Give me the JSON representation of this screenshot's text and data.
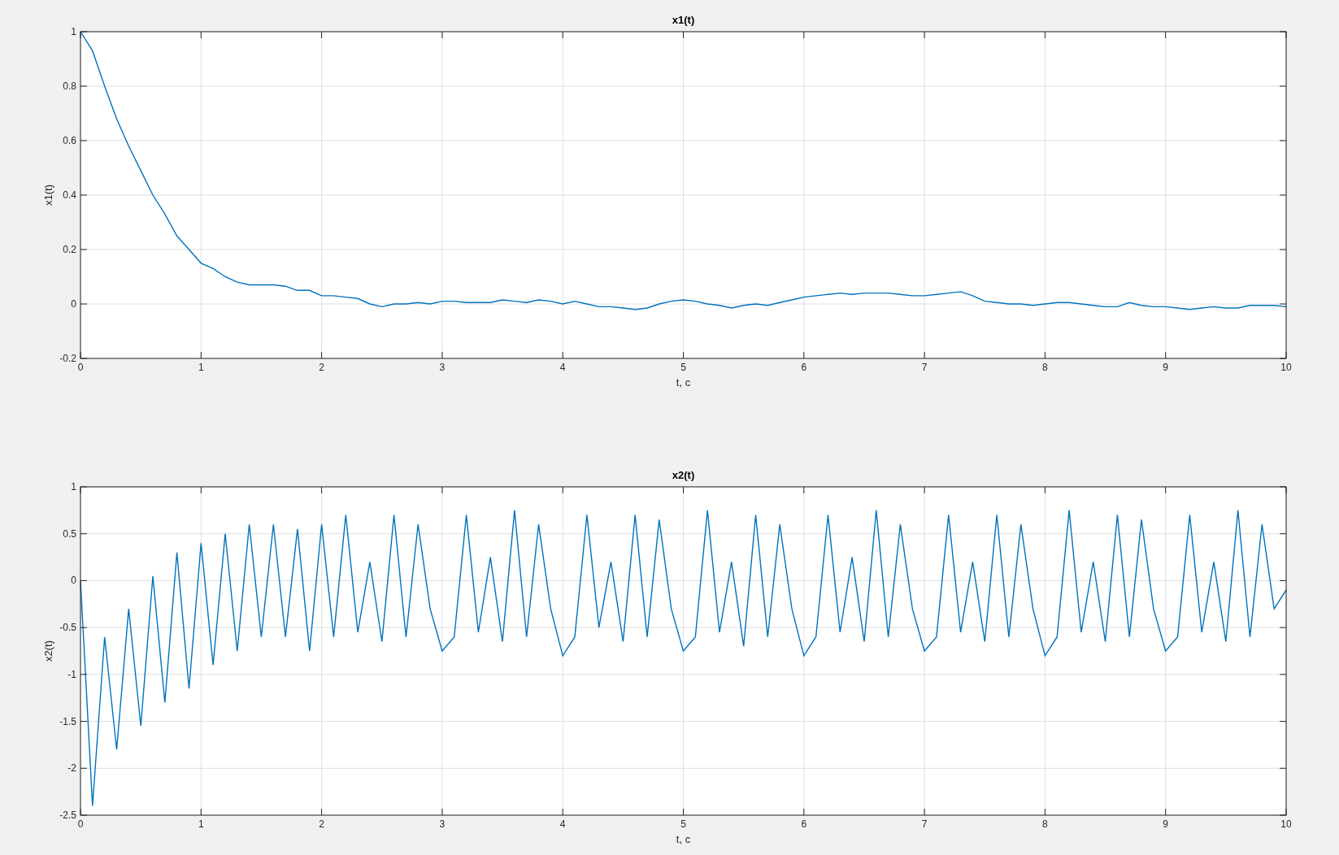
{
  "figure": {
    "plots": [
      {
        "chart_data": {
          "type": "line",
          "title": "x1(t)",
          "xlabel": "t, c",
          "ylabel": "x1(t)",
          "x": [
            0,
            0.1,
            0.2,
            0.3,
            0.4,
            0.5,
            0.6,
            0.7,
            0.8,
            0.9,
            1,
            1.1,
            1.2,
            1.3,
            1.4,
            1.5,
            1.6,
            1.7,
            1.8,
            1.9,
            2,
            2.1,
            2.2,
            2.3,
            2.4,
            2.5,
            2.6,
            2.7,
            2.8,
            2.9,
            3,
            3.1,
            3.2,
            3.3,
            3.4,
            3.5,
            3.6,
            3.7,
            3.8,
            3.9,
            4,
            4.1,
            4.2,
            4.3,
            4.4,
            4.5,
            4.6,
            4.7,
            4.8,
            4.9,
            5,
            5.1,
            5.2,
            5.3,
            5.4,
            5.5,
            5.6,
            5.7,
            5.8,
            5.9,
            6,
            6.1,
            6.2,
            6.3,
            6.4,
            6.5,
            6.6,
            6.7,
            6.8,
            6.9,
            7,
            7.1,
            7.2,
            7.3,
            7.4,
            7.5,
            7.6,
            7.7,
            7.8,
            7.9,
            8,
            8.1,
            8.2,
            8.3,
            8.4,
            8.5,
            8.6,
            8.7,
            8.8,
            8.9,
            9,
            9.1,
            9.2,
            9.3,
            9.4,
            9.5,
            9.6,
            9.7,
            9.8,
            9.9,
            10
          ],
          "series": [
            {
              "color": "#0072bd",
              "values": [
                1,
                0.93,
                0.8,
                0.68,
                0.58,
                0.49,
                0.4,
                0.33,
                0.25,
                0.2,
                0.15,
                0.13,
                0.1,
                0.08,
                0.07,
                0.07,
                0.07,
                0.065,
                0.05,
                0.05,
                0.03,
                0.03,
                0.025,
                0.02,
                0,
                -0.01,
                0,
                0,
                0.005,
                0,
                0.01,
                0.01,
                0.005,
                0.005,
                0.005,
                0.015,
                0.01,
                0.005,
                0.015,
                0.01,
                0,
                0.01,
                0,
                -0.01,
                -0.01,
                -0.015,
                -0.02,
                -0.015,
                0,
                0.01,
                0.015,
                0.01,
                0,
                -0.005,
                -0.015,
                -0.005,
                0,
                -0.005,
                0.005,
                0.015,
                0.025,
                0.03,
                0.035,
                0.04,
                0.035,
                0.04,
                0.04,
                0.04,
                0.035,
                0.03,
                0.03,
                0.035,
                0.04,
                0.045,
                0.03,
                0.01,
                0.005,
                0,
                0,
                -0.005,
                0,
                0.005,
                0.005,
                0,
                -0.005,
                -0.01,
                -0.01,
                0.005,
                -0.005,
                -0.01,
                -0.01,
                -0.015,
                -0.02,
                -0.015,
                -0.01,
                -0.015,
                -0.015,
                -0.005,
                -0.005,
                -0.005,
                -0.01
              ]
            }
          ],
          "xlim": [
            0,
            10
          ],
          "ylim": [
            -0.2,
            1
          ],
          "xticks": [
            0,
            1,
            2,
            3,
            4,
            5,
            6,
            7,
            8,
            9,
            10
          ],
          "yticks": [
            -0.2,
            0,
            0.2,
            0.4,
            0.6,
            0.8,
            1
          ],
          "grid": true
        }
      },
      {
        "chart_data": {
          "type": "line",
          "title": "x2(t)",
          "xlabel": "t, c",
          "ylabel": "x2(t)",
          "x": [
            0,
            0.1,
            0.2,
            0.3,
            0.4,
            0.5,
            0.6,
            0.7,
            0.8,
            0.9,
            1,
            1.1,
            1.2,
            1.3,
            1.4,
            1.5,
            1.6,
            1.7,
            1.8,
            1.9,
            2,
            2.1,
            2.2,
            2.3,
            2.4,
            2.5,
            2.6,
            2.7,
            2.8,
            2.9,
            3,
            3.1,
            3.2,
            3.3,
            3.4,
            3.5,
            3.6,
            3.7,
            3.8,
            3.9,
            4,
            4.1,
            4.2,
            4.3,
            4.4,
            4.5,
            4.6,
            4.7,
            4.8,
            4.9,
            5,
            5.1,
            5.2,
            5.3,
            5.4,
            5.5,
            5.6,
            5.7,
            5.8,
            5.9,
            6,
            6.1,
            6.2,
            6.3,
            6.4,
            6.5,
            6.6,
            6.7,
            6.8,
            6.9,
            7,
            7.1,
            7.2,
            7.3,
            7.4,
            7.5,
            7.6,
            7.7,
            7.8,
            7.9,
            8,
            8.1,
            8.2,
            8.3,
            8.4,
            8.5,
            8.6,
            8.7,
            8.8,
            8.9,
            9,
            9.1,
            9.2,
            9.3,
            9.4,
            9.5,
            9.6,
            9.7,
            9.8,
            9.9,
            10
          ],
          "series": [
            {
              "color": "#0072bd",
              "values": [
                0,
                -2.4,
                -0.6,
                -1.8,
                -0.3,
                -1.55,
                0.05,
                -1.3,
                0.3,
                -1.15,
                0.4,
                -0.9,
                0.5,
                -0.75,
                0.6,
                -0.6,
                0.6,
                -0.6,
                0.55,
                -0.75,
                0.6,
                -0.6,
                0.7,
                -0.55,
                0.2,
                -0.65,
                0.7,
                -0.6,
                0.6,
                -0.3,
                -0.75,
                -0.6,
                0.7,
                -0.55,
                0.25,
                -0.65,
                0.75,
                -0.6,
                0.6,
                -0.3,
                -0.8,
                -0.6,
                0.7,
                -0.5,
                0.2,
                -0.65,
                0.7,
                -0.6,
                0.65,
                -0.3,
                -0.75,
                -0.6,
                0.75,
                -0.55,
                0.2,
                -0.7,
                0.7,
                -0.6,
                0.6,
                -0.3,
                -0.8,
                -0.6,
                0.7,
                -0.55,
                0.25,
                -0.65,
                0.75,
                -0.6,
                0.6,
                -0.3,
                -0.75,
                -0.6,
                0.7,
                -0.55,
                0.2,
                -0.65,
                0.7,
                -0.6,
                0.6,
                -0.3,
                -0.8,
                -0.6,
                0.75,
                -0.55,
                0.2,
                -0.65,
                0.7,
                -0.6,
                0.65,
                -0.3,
                -0.75,
                -0.6,
                0.7,
                -0.55,
                0.2,
                -0.65,
                0.75,
                -0.6,
                0.6,
                -0.3,
                -0.1
              ]
            }
          ],
          "xlim": [
            0,
            10
          ],
          "ylim": [
            -2.5,
            1
          ],
          "xticks": [
            0,
            1,
            2,
            3,
            4,
            5,
            6,
            7,
            8,
            9,
            10
          ],
          "yticks": [
            -2.5,
            -2,
            -1.5,
            -1,
            -0.5,
            0,
            0.5,
            1
          ],
          "grid": true
        }
      }
    ]
  }
}
